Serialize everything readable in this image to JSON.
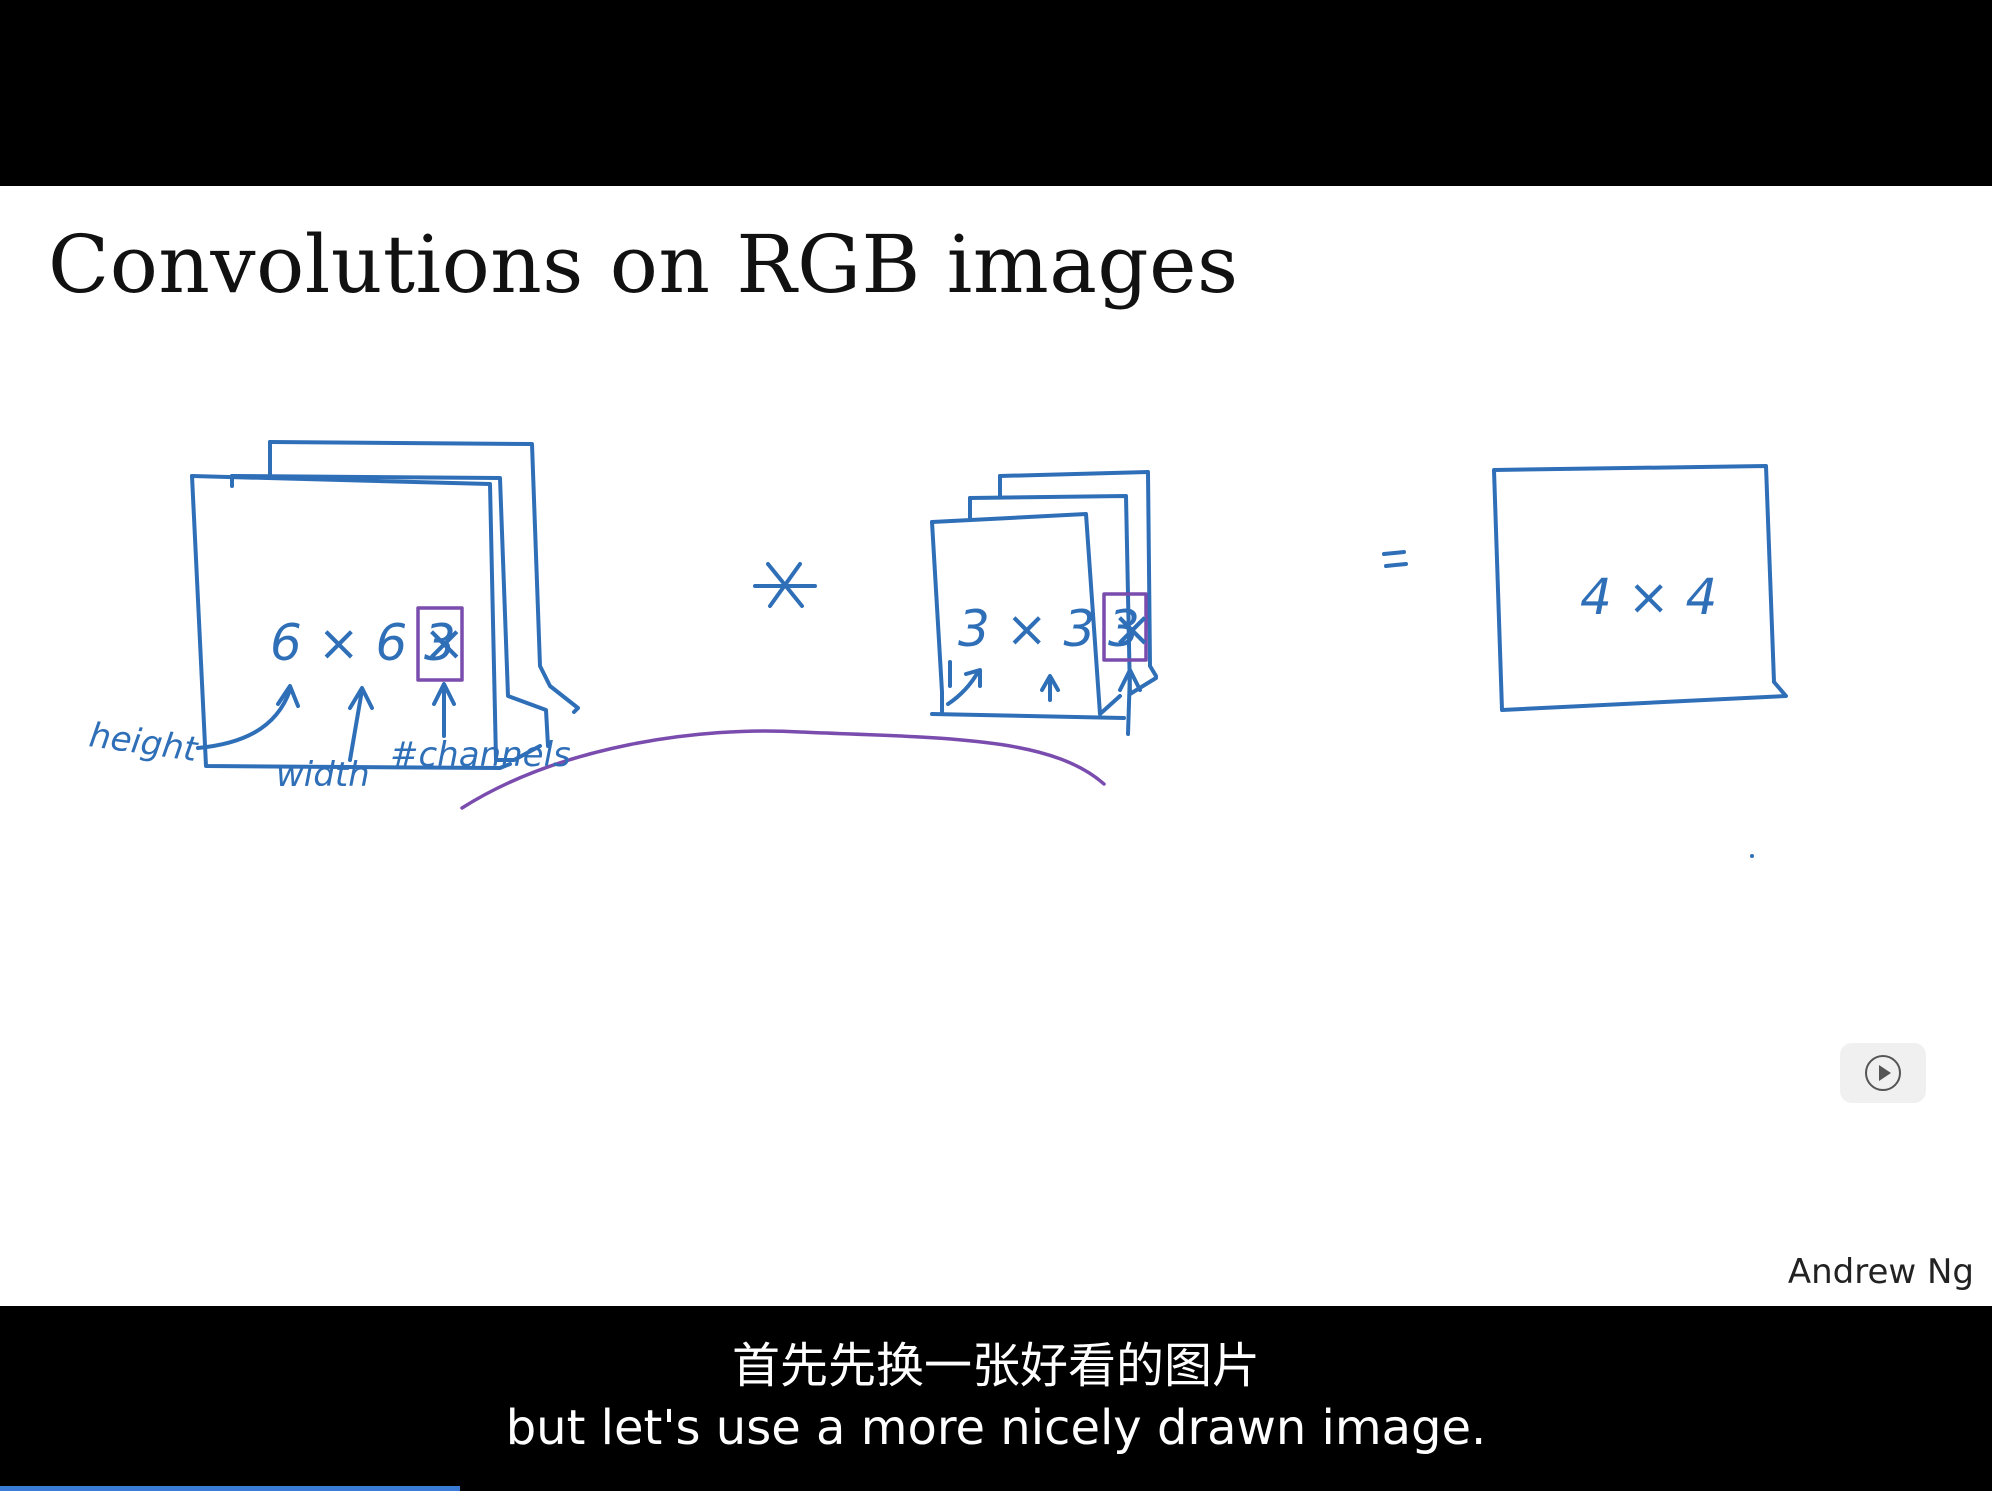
{
  "slide": {
    "title": "Convolutions on RGB images",
    "author": "Andrew Ng"
  },
  "annotations": {
    "input_dims": "6 × 6 ×",
    "input_channels": "3",
    "filter_dims": "3 × 3 ×",
    "filter_channels": "3",
    "output_dims": "4 × 4",
    "label_height": "height",
    "label_width": "width",
    "label_channels": "#channels",
    "operator_convolve": "*",
    "operator_equals": "="
  },
  "subtitles": {
    "chinese": "首先先换一张好看的图片",
    "english": "but let's use a more nicely drawn image."
  },
  "colors": {
    "ink_blue": "#2f6fb8",
    "ink_purple": "#7a4cae",
    "progress": "#3a7bd5"
  },
  "icons": {
    "player_control": "play-icon"
  }
}
